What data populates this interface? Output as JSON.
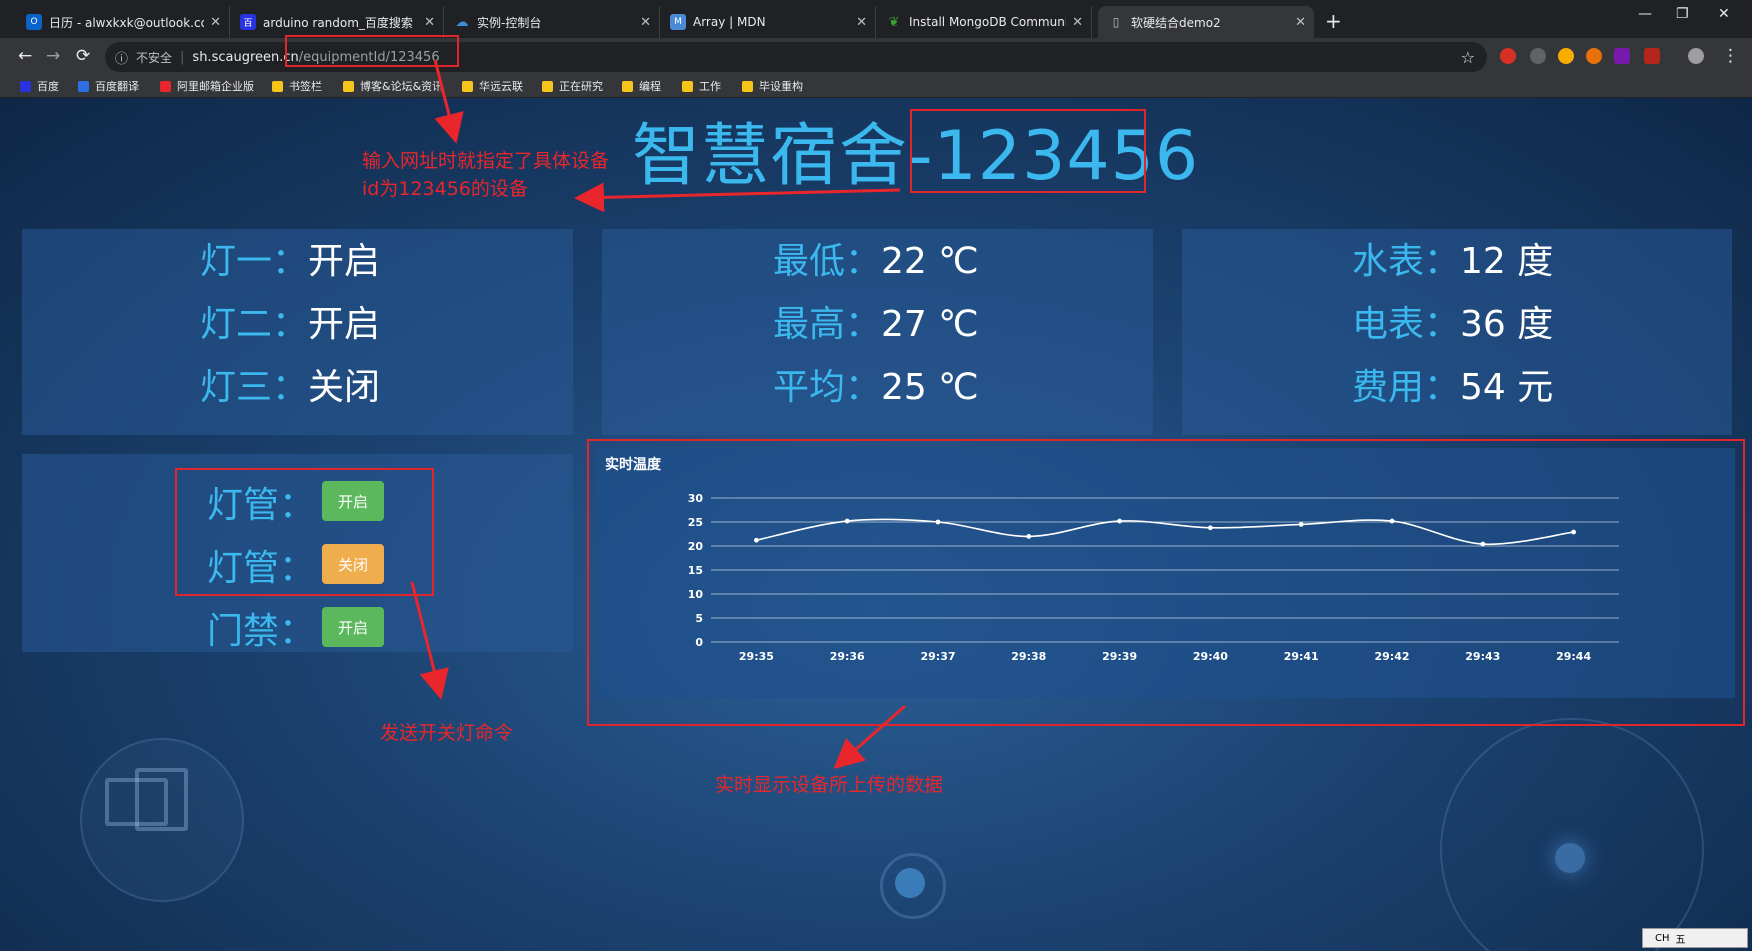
{
  "browser": {
    "tabs": [
      {
        "title": "日历 - alwxkxk@outlook.com",
        "icon": "outlook-icon",
        "color": "#0a64c9"
      },
      {
        "title": "arduino random_百度搜索",
        "icon": "baidu-icon",
        "color": "#2932e1"
      },
      {
        "title": "实例-控制台",
        "icon": "cloud-icon",
        "color": "#3c8ed8"
      },
      {
        "title": "Array | MDN",
        "icon": "mdn-icon",
        "color": "#4a8bd6"
      },
      {
        "title": "Install MongoDB Community E",
        "icon": "mongodb-leaf-icon",
        "color": "#3fa037"
      },
      {
        "title": "软硬结合demo2",
        "icon": "page-icon",
        "color": "#9aa0a6"
      }
    ],
    "address": {
      "security_label": "不安全",
      "host": "sh.scaugreen.cn",
      "path": "/equipmentId/123456"
    },
    "bookmarks": [
      "百度",
      "百度翻译",
      "阿里邮箱企业版",
      "书签栏",
      "博客&论坛&资讯",
      "华远云联",
      "正在研究",
      "编程",
      "工作",
      "毕设重构"
    ]
  },
  "page": {
    "title_prefix": "智慧宿舍-",
    "device_id": "123456",
    "lights": [
      {
        "label": "灯一：",
        "value": "开启"
      },
      {
        "label": "灯二：",
        "value": "开启"
      },
      {
        "label": "灯三：",
        "value": "关闭"
      }
    ],
    "temperature": [
      {
        "label": "最低：",
        "value": "22 ℃"
      },
      {
        "label": "最高：",
        "value": "27 ℃"
      },
      {
        "label": "平均：",
        "value": "25 ℃"
      }
    ],
    "meters": [
      {
        "label": "水表：",
        "value": "12 度"
      },
      {
        "label": "电表：",
        "value": "36 度"
      },
      {
        "label": "费用：",
        "value": "54 元"
      }
    ],
    "controls": [
      {
        "label": "灯管：",
        "button": "开启",
        "state": "on"
      },
      {
        "label": "灯管：",
        "button": "关闭",
        "state": "off"
      },
      {
        "label": "门禁：",
        "button": "开启",
        "state": "on"
      }
    ]
  },
  "annotations": {
    "url_note_line1": "输入网址时就指定了具体设备",
    "url_note_line2": "id为123456的设备",
    "command_note": "发送开关灯命令",
    "realtime_note": "实时显示设备所上传的数据"
  },
  "ime": {
    "lang": "CH",
    "mode": "五"
  },
  "chart_data": {
    "type": "line",
    "title": "实时温度",
    "categories": [
      "29:35",
      "29:36",
      "29:37",
      "29:38",
      "29:39",
      "29:40",
      "29:41",
      "29:42",
      "29:43",
      "29:44"
    ],
    "series": [
      {
        "values": [
          21.2,
          25.2,
          25.0,
          22.0,
          25.2,
          23.8,
          24.5,
          25.2,
          20.4,
          22.9
        ]
      }
    ],
    "ylim": [
      0,
      30
    ],
    "yticks": [
      0,
      5,
      10,
      15,
      20,
      25,
      30
    ],
    "grid": true,
    "line_color": "#ffffff"
  }
}
